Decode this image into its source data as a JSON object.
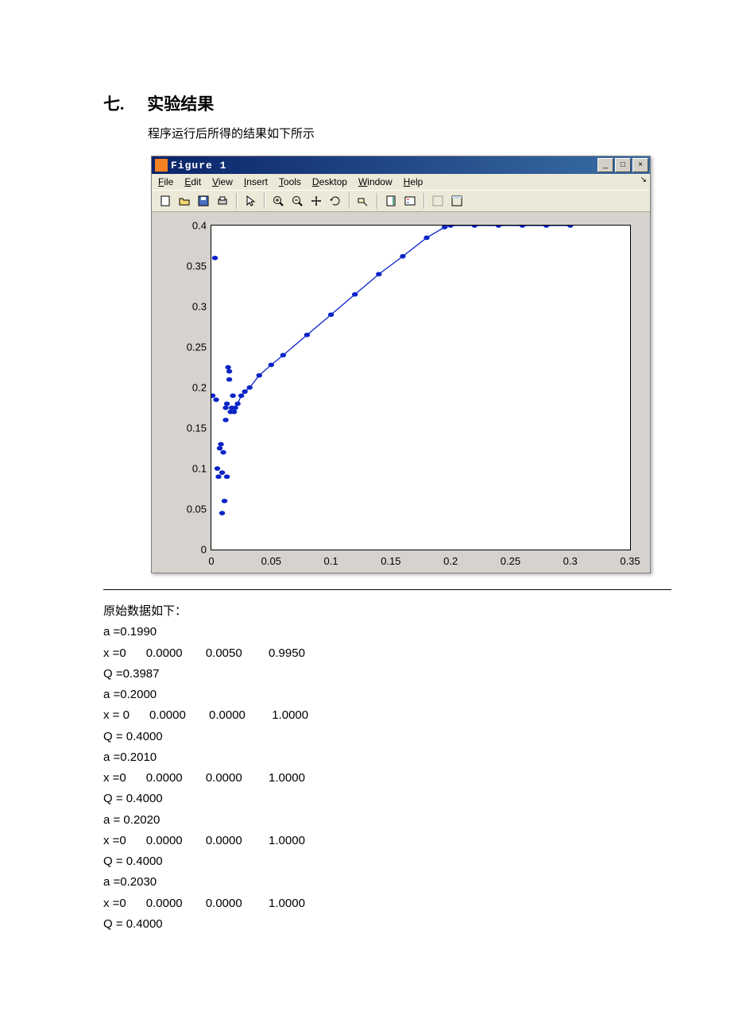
{
  "heading": {
    "num": "七.",
    "title": "实验结果"
  },
  "intro": "程序运行后所得的结果如下所示",
  "window": {
    "title": "Figure 1",
    "menus": [
      "File",
      "Edit",
      "View",
      "Insert",
      "Tools",
      "Desktop",
      "Window",
      "Help"
    ],
    "toolbar_names": [
      "new",
      "open",
      "save",
      "print",
      "arrow",
      "zoom-in",
      "zoom-out",
      "pan",
      "rotate",
      "data-cursor",
      "colorbar",
      "legend",
      "hide",
      "show"
    ],
    "buttons": {
      "min": "_",
      "max": "□",
      "close": "×"
    }
  },
  "chart_data": {
    "type": "scatter",
    "xlim": [
      0,
      0.35
    ],
    "ylim": [
      0,
      0.4
    ],
    "xticks": [
      0,
      0.05,
      0.1,
      0.15,
      0.2,
      0.25,
      0.3,
      0.35
    ],
    "yticks": [
      0,
      0.05,
      0.1,
      0.15,
      0.2,
      0.25,
      0.3,
      0.35,
      0.4
    ],
    "scatter_points": [
      [
        0.001,
        0.19
      ],
      [
        0.003,
        0.36
      ],
      [
        0.004,
        0.185
      ],
      [
        0.005,
        0.1
      ],
      [
        0.006,
        0.09
      ],
      [
        0.007,
        0.125
      ],
      [
        0.008,
        0.13
      ],
      [
        0.009,
        0.045
      ],
      [
        0.01,
        0.12
      ],
      [
        0.011,
        0.06
      ],
      [
        0.012,
        0.16
      ],
      [
        0.012,
        0.175
      ],
      [
        0.013,
        0.18
      ],
      [
        0.014,
        0.225
      ],
      [
        0.015,
        0.22
      ],
      [
        0.015,
        0.21
      ],
      [
        0.016,
        0.17
      ],
      [
        0.017,
        0.175
      ],
      [
        0.018,
        0.19
      ],
      [
        0.013,
        0.09
      ],
      [
        0.009,
        0.095
      ]
    ],
    "line_points": [
      [
        0.019,
        0.17
      ],
      [
        0.02,
        0.175
      ],
      [
        0.022,
        0.18
      ],
      [
        0.025,
        0.19
      ],
      [
        0.028,
        0.195
      ],
      [
        0.032,
        0.2
      ],
      [
        0.04,
        0.215
      ],
      [
        0.05,
        0.228
      ],
      [
        0.06,
        0.24
      ],
      [
        0.08,
        0.265
      ],
      [
        0.1,
        0.29
      ],
      [
        0.12,
        0.315
      ],
      [
        0.14,
        0.34
      ],
      [
        0.16,
        0.362
      ],
      [
        0.18,
        0.385
      ],
      [
        0.195,
        0.398
      ],
      [
        0.2,
        0.4
      ],
      [
        0.22,
        0.4
      ],
      [
        0.24,
        0.4
      ],
      [
        0.26,
        0.4
      ],
      [
        0.28,
        0.4
      ],
      [
        0.3,
        0.4
      ]
    ]
  },
  "raw_data": {
    "label": "原始数据如下：",
    "lines": [
      "a =0.1990",
      "x =0      0.0000       0.0050        0.9950",
      "Q =0.3987",
      "a =0.2000",
      "x = 0      0.0000       0.0000        1.0000",
      "Q = 0.4000",
      "a =0.2010",
      "x =0      0.0000       0.0000        1.0000",
      "Q = 0.4000",
      "a = 0.2020",
      "x =0      0.0000       0.0000        1.0000",
      "Q = 0.4000",
      "a =0.2030",
      "x =0      0.0000       0.0000        1.0000",
      "Q = 0.4000"
    ]
  }
}
